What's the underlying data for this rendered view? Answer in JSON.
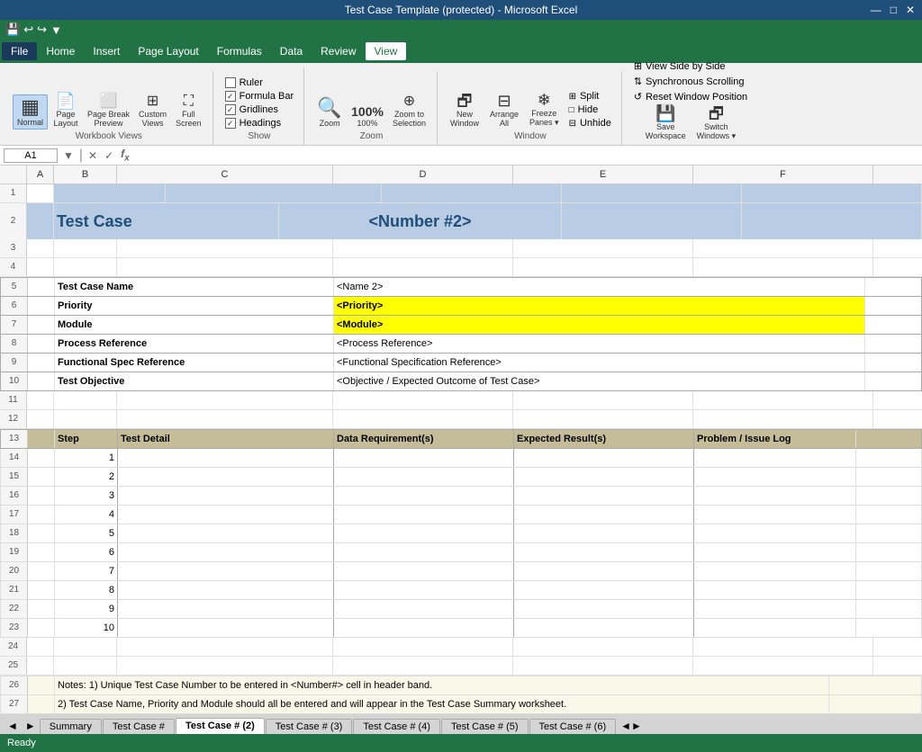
{
  "titleBar": {
    "text": "Test Case Template (protected) - Microsoft Excel",
    "windowControls": [
      "—",
      "□",
      "✕"
    ]
  },
  "quickAccess": {
    "icons": [
      "💾",
      "↩",
      "↪",
      "▼"
    ]
  },
  "menuBar": {
    "items": [
      "File",
      "Home",
      "Insert",
      "Page Layout",
      "Formulas",
      "Data",
      "Review",
      "View"
    ],
    "activeItem": "View"
  },
  "ribbon": {
    "groups": [
      {
        "name": "Workbook Views",
        "label": "Workbook Views",
        "buttons": [
          {
            "id": "normal",
            "label": "Normal",
            "icon": "▦",
            "active": true
          },
          {
            "id": "page-layout",
            "label": "Page\nLayout",
            "icon": "📄"
          },
          {
            "id": "page-break",
            "label": "Page Break\nPreview",
            "icon": "⬜"
          },
          {
            "id": "custom-views",
            "label": "Custom\nViews",
            "icon": "⊞"
          },
          {
            "id": "full-screen",
            "label": "Full\nScreen",
            "icon": "⛶"
          }
        ]
      },
      {
        "name": "Show",
        "label": "Show",
        "checkboxes": [
          {
            "id": "ruler",
            "label": "Ruler",
            "checked": false
          },
          {
            "id": "formula-bar",
            "label": "Formula Bar",
            "checked": true
          },
          {
            "id": "gridlines",
            "label": "Gridlines",
            "checked": true
          },
          {
            "id": "headings",
            "label": "Headings",
            "checked": true
          }
        ]
      },
      {
        "name": "Zoom",
        "label": "Zoom",
        "buttons": [
          {
            "id": "zoom",
            "label": "Zoom",
            "icon": "🔍"
          },
          {
            "id": "zoom-100",
            "label": "100%",
            "icon": ""
          },
          {
            "id": "zoom-selection",
            "label": "Zoom to\nSelection",
            "icon": "⊕"
          }
        ]
      },
      {
        "name": "Window",
        "label": "Window",
        "buttons": [
          {
            "id": "new-window",
            "label": "New\nWindow",
            "icon": "🗗"
          },
          {
            "id": "arrange-all",
            "label": "Arrange\nAll",
            "icon": "⊟"
          },
          {
            "id": "freeze-panes",
            "label": "Freeze\nPanes",
            "icon": "❄"
          }
        ],
        "splits": [
          {
            "id": "split",
            "label": "Split"
          },
          {
            "id": "hide",
            "label": "Hide"
          },
          {
            "id": "unhide",
            "label": "Unhide"
          }
        ]
      },
      {
        "name": "WorkspaceWindow",
        "label": "",
        "rightButtons": [
          {
            "id": "view-side",
            "label": "View Side by Side"
          },
          {
            "id": "sync-scroll",
            "label": "Synchronous Scrolling"
          },
          {
            "id": "reset-window",
            "label": "Reset Window Position"
          },
          {
            "id": "save-workspace",
            "label": "Save\nWorkspace"
          },
          {
            "id": "switch-windows",
            "label": "Switch\nWindows"
          }
        ]
      }
    ]
  },
  "formulaBar": {
    "cellRef": "A1",
    "formula": ""
  },
  "columns": [
    "A",
    "B",
    "C",
    "D",
    "E",
    "F"
  ],
  "spreadsheet": {
    "titleRow": {
      "left": "Test Case",
      "right": "<Number #2>",
      "bg": "#b8cce4"
    },
    "infoRows": [
      {
        "label": "Test Case Name",
        "value": "<Name 2>",
        "labelBold": true,
        "valueBold": false,
        "bg": "white",
        "valueBg": "white"
      },
      {
        "label": "Priority",
        "value": "<Priority>",
        "labelBold": true,
        "valueBold": true,
        "bg": "white",
        "valueBg": "#ffff00"
      },
      {
        "label": "Module",
        "value": "<Module>",
        "labelBold": true,
        "valueBold": true,
        "bg": "white",
        "valueBg": "#ffff00"
      },
      {
        "label": "Process Reference",
        "value": "<Process Reference>",
        "labelBold": true,
        "valueBold": false,
        "bg": "white",
        "valueBg": "white"
      },
      {
        "label": "Functional Spec Reference",
        "value": "<Functional Specification Reference>",
        "labelBold": true,
        "valueBold": false,
        "bg": "white",
        "valueBg": "white"
      },
      {
        "label": "Test Objective",
        "value": "<Objective / Expected Outcome of Test Case>",
        "labelBold": true,
        "valueBold": false,
        "bg": "white",
        "valueBg": "white"
      }
    ],
    "tableHeaders": [
      "Step",
      "Test Detail",
      "Data Requirement(s)",
      "Expected Result(s)",
      "Problem / Issue Log"
    ],
    "tableRows": [
      1,
      2,
      3,
      4,
      5,
      6,
      7,
      8,
      9,
      10
    ],
    "notes": [
      "Notes:   1) Unique Test Case Number to be entered in <Number#> cell in header band.",
      "          2) Test Case Name, Priority and Module should all be entered and will appear in the Test Case Summary worksheet."
    ]
  },
  "sheetTabs": [
    "Summary",
    "Test Case #",
    "Test Case # (2)",
    "Test Case # (3)",
    "Test Case # (4)",
    "Test Case # (5)",
    "Test Case # (6)"
  ],
  "activeTab": "Test Case # (2)",
  "statusBar": {
    "text": "Ready"
  }
}
